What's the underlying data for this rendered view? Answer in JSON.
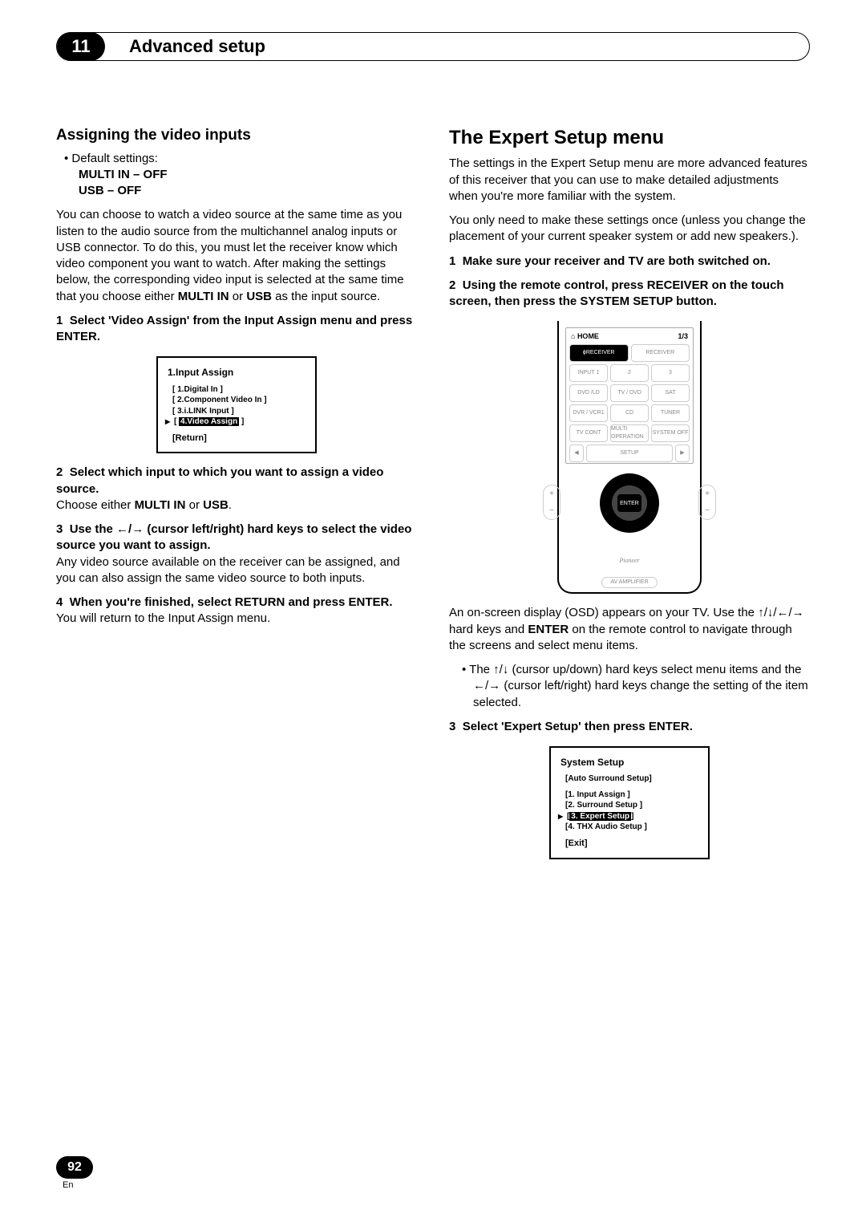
{
  "chapter": {
    "number": "11",
    "title": "Advanced setup"
  },
  "footer": {
    "page": "92",
    "lang": "En"
  },
  "left": {
    "heading": "Assigning the video inputs",
    "bullet": "Default settings:",
    "defaults1": "MULTI IN – OFF",
    "defaults2": "USB – OFF",
    "para1a": "You can choose to watch a video source at the same time as you listen to the audio source from the multichannel analog inputs or USB connector. To do this, you must let the receiver know which video component you want to watch. After making the settings below, the corresponding video input is selected at the same time that you choose either ",
    "para1b": "MULTI IN",
    "para1c": " or ",
    "para1d": "USB",
    "para1e": " as the input source.",
    "step1": {
      "num": "1",
      "title": "Select 'Video Assign' from the Input Assign menu and press ENTER."
    },
    "osd1": {
      "title": "1.Input Assign",
      "i1": "[ 1.Digital In ]",
      "i2": "[ 2.Component Video In ]",
      "i3": "[ 3.i.LINK Input ]",
      "i4a": "[ ",
      "i4sel": "4.Video Assign",
      "i4b": " ]",
      "ret": "[Return]"
    },
    "step2": {
      "num": "2",
      "title": "Select which input to which you want to assign a video source.",
      "body_a": "Choose either ",
      "body_b": "MULTI IN",
      "body_c": " or ",
      "body_d": "USB",
      "body_e": "."
    },
    "step3": {
      "num": "3",
      "title_a": "Use the ",
      "title_b": " (cursor left/right) hard keys to select the video source you want to assign.",
      "body": "Any video source available on the receiver can be assigned, and you can also assign the same video source to both inputs."
    },
    "step4": {
      "num": "4",
      "title": "When you're finished, select RETURN and press ENTER.",
      "body": "You will return to the Input Assign menu."
    }
  },
  "right": {
    "heading": "The Expert Setup menu",
    "para1": "The settings in the Expert Setup menu are more advanced features of this receiver that you can use to make detailed adjustments when you're more familiar with the system.",
    "para2": "You only need to make these settings once (unless you change the placement of your current speaker system or add new speakers.).",
    "step1": {
      "num": "1",
      "title": "Make sure your receiver and TV are both switched on."
    },
    "step2": {
      "num": "2",
      "title": "Using the remote control, press RECEIVER on the touch screen, then press the SYSTEM SETUP button."
    },
    "remote": {
      "home": "HOME",
      "page": "1/3",
      "recv_on": "RECEIVER",
      "recv_off": "RECEIVER",
      "in1": "INPUT 1",
      "in2": "2",
      "in3": "3",
      "dvd": "DVD /LD",
      "tvdvd": "TV / DVD",
      "sat": "SAT",
      "dvr": "DVR / VCR1",
      "cd": "CD",
      "tuner": "TUNER",
      "tvcont": "TV CONT",
      "multi": "MULTI OPERATION",
      "sysoff": "SYSTEM OFF",
      "setup": "SETUP",
      "enter": "ENTER",
      "brand": "Pioneer",
      "model": "AV AMPLIFIER"
    },
    "para3a": "An on-screen display (OSD) appears on your TV. Use the ",
    "para3b": " hard keys and ",
    "para3c": "ENTER",
    "para3d": " on the remote control to navigate through the screens and select menu items.",
    "bullet_a": "The ",
    "bullet_b": " (cursor up/down) hard keys select menu items and the ",
    "bullet_c": " (cursor left/right) hard keys change the setting of the item selected.",
    "step3": {
      "num": "3",
      "title": "Select 'Expert Setup' then press ENTER."
    },
    "osd2": {
      "title": "System Setup",
      "auto": "[Auto Surround Setup]",
      "i1": "[1. Input Assign ]",
      "i2": "[2. Surround Setup ]",
      "i3a": "[",
      "i3sel": "3. Expert Setup",
      "i3b": "]",
      "i4": "[4. THX Audio Setup ]",
      "exit": "[Exit]"
    }
  },
  "arrows": {
    "lr": "←/→",
    "ud": "↑/↓",
    "all": "↑/↓/←/→"
  }
}
